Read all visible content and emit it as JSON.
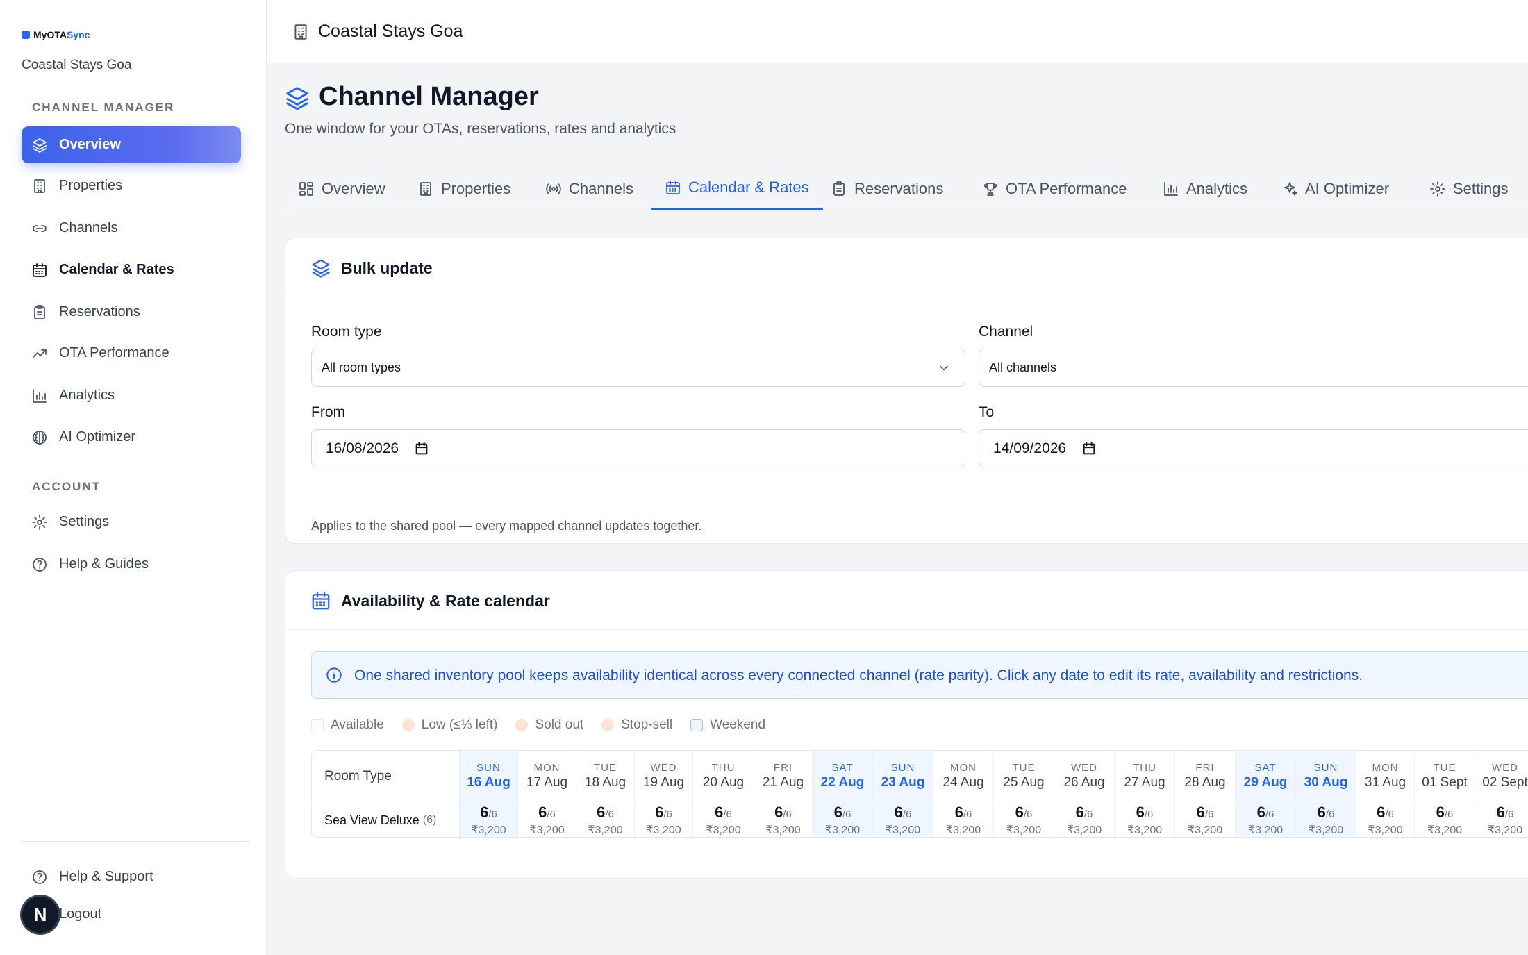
{
  "brand": {
    "name_prefix": "MyOTA",
    "name_suffix": "Sync"
  },
  "sidebar": {
    "property": "Coastal Stays Goa",
    "section_channel": "CHANNEL MANAGER",
    "items": [
      {
        "label": "Overview",
        "icon": "layers-icon"
      },
      {
        "label": "Properties",
        "icon": "building-icon"
      },
      {
        "label": "Channels",
        "icon": "link-icon"
      },
      {
        "label": "Calendar & Rates",
        "icon": "calendar-icon"
      },
      {
        "label": "Reservations",
        "icon": "clipboard-icon"
      },
      {
        "label": "OTA Performance",
        "icon": "trending-up-icon"
      },
      {
        "label": "Analytics",
        "icon": "bar-chart-icon"
      },
      {
        "label": "AI Optimizer",
        "icon": "brain-icon"
      }
    ],
    "section_account": "ACCOUNT",
    "account_items": [
      {
        "label": "Settings",
        "icon": "gear-icon"
      },
      {
        "label": "Help & Guides",
        "icon": "help-circle-icon"
      }
    ],
    "footer_items": [
      {
        "label": "Help & Support",
        "icon": "help-circle-icon"
      },
      {
        "label": "Logout",
        "icon": "logout-icon"
      }
    ],
    "avatar_letter": "N"
  },
  "topbar": {
    "title": "Coastal Stays Goa"
  },
  "header": {
    "title": "Channel Manager",
    "subtitle": "One window for your OTAs, reservations, rates and analytics"
  },
  "tabs": [
    {
      "label": "Overview"
    },
    {
      "label": "Properties"
    },
    {
      "label": "Channels"
    },
    {
      "label": "Calendar & Rates",
      "active": true
    },
    {
      "label": "Reservations"
    },
    {
      "label": "OTA Performance"
    },
    {
      "label": "Analytics"
    },
    {
      "label": "AI Optimizer"
    },
    {
      "label": "Settings"
    }
  ],
  "bulk": {
    "title": "Bulk update",
    "room_type_label": "Room type",
    "room_type_value": "All room types",
    "channel_label": "Channel",
    "channel_value": "All channels",
    "from_label": "From",
    "from_value": "16/08/2026",
    "to_label": "To",
    "to_value": "14/09/2026",
    "hint": "Applies to the shared pool — every mapped channel updates together."
  },
  "calendar": {
    "title": "Availability & Rate calendar",
    "info": "One shared inventory pool keeps availability identical across every connected channel (rate parity). Click any date to edit its rate, availability and restrictions.",
    "legend": [
      {
        "label": "Available",
        "color": "#ffffff",
        "border": "#e5e7eb"
      },
      {
        "label": "Low (≤⅓ left)",
        "color": "#fde3d4",
        "border": "#fde3d4"
      },
      {
        "label": "Sold out",
        "color": "#fde3d4",
        "border": "#fde3d4"
      },
      {
        "label": "Stop-sell",
        "color": "#fde3d4",
        "border": "#fde3d4"
      },
      {
        "label": "Weekend",
        "color": "#eff6ff",
        "border": "#bfdbfe"
      }
    ],
    "room_type_header": "Room Type",
    "room": {
      "name": "Sea View Deluxe",
      "count": "(6)"
    },
    "days": [
      {
        "dow": "SUN",
        "date": "16 Aug",
        "weekend": true,
        "avail": "6",
        "total": "/6",
        "rate": "₹3,200"
      },
      {
        "dow": "MON",
        "date": "17 Aug",
        "weekend": false,
        "avail": "6",
        "total": "/6",
        "rate": "₹3,200"
      },
      {
        "dow": "TUE",
        "date": "18 Aug",
        "weekend": false,
        "avail": "6",
        "total": "/6",
        "rate": "₹3,200"
      },
      {
        "dow": "WED",
        "date": "19 Aug",
        "weekend": false,
        "avail": "6",
        "total": "/6",
        "rate": "₹3,200"
      },
      {
        "dow": "THU",
        "date": "20 Aug",
        "weekend": false,
        "avail": "6",
        "total": "/6",
        "rate": "₹3,200"
      },
      {
        "dow": "FRI",
        "date": "21 Aug",
        "weekend": false,
        "avail": "6",
        "total": "/6",
        "rate": "₹3,200"
      },
      {
        "dow": "SAT",
        "date": "22 Aug",
        "weekend": true,
        "avail": "6",
        "total": "/6",
        "rate": "₹3,200"
      },
      {
        "dow": "SUN",
        "date": "23 Aug",
        "weekend": true,
        "avail": "6",
        "total": "/6",
        "rate": "₹3,200"
      },
      {
        "dow": "MON",
        "date": "24 Aug",
        "weekend": false,
        "avail": "6",
        "total": "/6",
        "rate": "₹3,200"
      },
      {
        "dow": "TUE",
        "date": "25 Aug",
        "weekend": false,
        "avail": "6",
        "total": "/6",
        "rate": "₹3,200"
      },
      {
        "dow": "WED",
        "date": "26 Aug",
        "weekend": false,
        "avail": "6",
        "total": "/6",
        "rate": "₹3,200"
      },
      {
        "dow": "THU",
        "date": "27 Aug",
        "weekend": false,
        "avail": "6",
        "total": "/6",
        "rate": "₹3,200"
      },
      {
        "dow": "FRI",
        "date": "28 Aug",
        "weekend": false,
        "avail": "6",
        "total": "/6",
        "rate": "₹3,200"
      },
      {
        "dow": "SAT",
        "date": "29 Aug",
        "weekend": true,
        "avail": "6",
        "total": "/6",
        "rate": "₹3,200"
      },
      {
        "dow": "SUN",
        "date": "30 Aug",
        "weekend": true,
        "avail": "6",
        "total": "/6",
        "rate": "₹3,200"
      },
      {
        "dow": "MON",
        "date": "31 Aug",
        "weekend": false,
        "avail": "6",
        "total": "/6",
        "rate": "₹3,200"
      },
      {
        "dow": "TUE",
        "date": "01 Sept",
        "weekend": false,
        "avail": "6",
        "total": "/6",
        "rate": "₹3,200"
      },
      {
        "dow": "WED",
        "date": "02 Sept",
        "weekend": false,
        "avail": "6",
        "total": "/6",
        "rate": "₹3,200"
      }
    ]
  },
  "colors": {
    "accent": "#2563eb",
    "weekend_bg": "#eff6ff",
    "active_nav": "#3b63e8"
  }
}
